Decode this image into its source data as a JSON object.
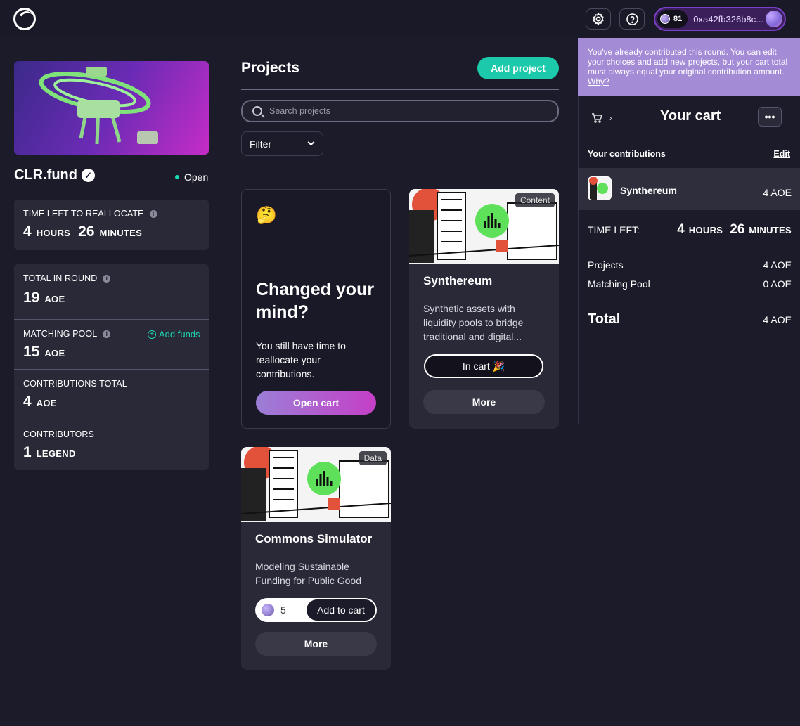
{
  "header": {
    "balance": "81",
    "address": "0xa42fb326b8c..."
  },
  "round": {
    "name": "CLR.fund",
    "status": "Open",
    "time_left_label": "TIME LEFT TO REALLOCATE",
    "time_hours": "4",
    "hours_unit": "hours",
    "time_minutes": "26",
    "minutes_unit": "minutes",
    "total_label": "TOTAL IN ROUND",
    "total_value": "19",
    "total_unit": "aoe",
    "matching_label": "MATCHING POOL",
    "add_funds": "Add funds",
    "matching_value": "15",
    "matching_unit": "aoe",
    "contrib_label": "CONTRIBUTIONS TOTAL",
    "contrib_value": "4",
    "contrib_unit": "aoe",
    "contributors_label": "CONTRIBUTORS",
    "contributors_value": "1",
    "contributors_unit": "legend"
  },
  "projects": {
    "title": "Projects",
    "add_button": "Add project",
    "search_placeholder": "Search projects",
    "filter_label": "Filter",
    "change_card": {
      "emoji": "🤔",
      "title": "Changed your mind?",
      "desc": "You still have time to reallocate your contributions.",
      "button": "Open cart"
    },
    "items": [
      {
        "badge": "Content",
        "title": "Synthereum",
        "desc": "Synthetic assets with liquidity pools to bridge traditional and digital...",
        "primary": "In cart 🎉",
        "more": "More"
      },
      {
        "badge": "Data",
        "title": "Commons Simulator",
        "desc": "Modeling Sustainable Funding for Public Good",
        "amount": "5",
        "primary": "Add to cart",
        "more": "More"
      }
    ]
  },
  "cart": {
    "notice": "You've already contributed this round. You can edit your choices and add new projects, but your cart total must always equal your original contribution amount.",
    "notice_link": "Why?",
    "title": "Your cart",
    "contributions_label": "Your contributions",
    "edit": "Edit",
    "item_name": "Synthereum",
    "item_amount": "4 AOE",
    "time_left_label": "TIME LEFT:",
    "time_hours": "4",
    "hours_unit": "hours",
    "time_minutes": "26",
    "minutes_unit": "minutes",
    "projects_label": "Projects",
    "projects_value": "4 AOE",
    "pool_label": "Matching Pool",
    "pool_value": "0 AOE",
    "total_label": "Total",
    "total_value": "4 AOE"
  }
}
